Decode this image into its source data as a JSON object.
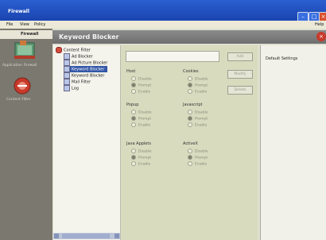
{
  "window": {
    "title": "Firewall"
  },
  "menubar": {
    "items": [
      "File",
      "View",
      "Policy"
    ],
    "help": "Help"
  },
  "nav": {
    "header": "Firewall",
    "items": [
      {
        "label": "Application Firewall",
        "icon": "firewall-icon"
      },
      {
        "label": "Content Filter",
        "icon": "content-filter-icon"
      }
    ]
  },
  "panel": {
    "title": "Keyword Blocker"
  },
  "tree": {
    "root": "Content Filter",
    "items": [
      "Ad Blocker",
      "Ad Picture Blocker",
      "Keyword Blocker",
      "Keyword Blocker",
      "Mail Filter",
      "Log"
    ],
    "selected_index": 2
  },
  "settings": {
    "input_value": "",
    "buttons": {
      "add": "Add",
      "modify": "Modify",
      "delete": "Delete"
    },
    "groups": [
      {
        "title": "Host",
        "options": [
          "Disable",
          "Prompt",
          "Enable"
        ],
        "selected": 1
      },
      {
        "title": "Cookies",
        "options": [
          "Disable",
          "Prompt",
          "Enable"
        ],
        "selected": 1
      },
      {
        "title": "Popup",
        "options": [
          "Disable",
          "Prompt",
          "Enable"
        ],
        "selected": 1
      },
      {
        "title": "Javascript",
        "options": [
          "Disable",
          "Prompt",
          "Enable"
        ],
        "selected": 1
      },
      {
        "title": "Java Applets",
        "options": [
          "Disable",
          "Prompt",
          "Enable"
        ],
        "selected": 1
      },
      {
        "title": "ActiveX",
        "options": [
          "Disable",
          "Prompt",
          "Enable"
        ],
        "selected": 1
      }
    ]
  },
  "right_pane": {
    "label": "Default Settings"
  }
}
